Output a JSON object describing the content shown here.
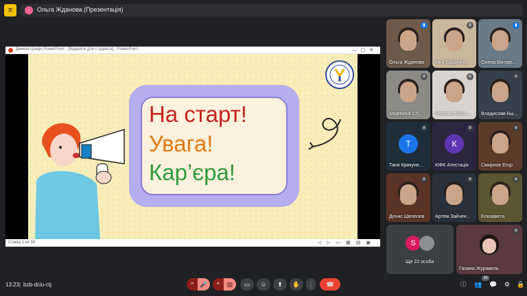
{
  "topbar": {
    "presenter": "Ольга Жданова (Презентація)"
  },
  "ppt": {
    "window_title": "Демонстрація PowerPoint - [Відкрити для студента] - PowerPoint",
    "status": "Слайд 1 из 18"
  },
  "slide": {
    "line1": "На старт!",
    "line2": "Увага!",
    "line3": "Кар’єра!",
    "colors": {
      "line1": "#c1231f",
      "line2": "#e07b17",
      "line3": "#2e9b3c",
      "frame": "#b7aef0"
    }
  },
  "participants": [
    {
      "name": "Ольга Жданова",
      "kind": "video",
      "bg": "#6d5a4a",
      "mic": "active"
    },
    {
      "name": "Інна Бардічев...",
      "kind": "video",
      "bg": "#c9b79e",
      "mic": "muted"
    },
    {
      "name": "Олена Вікторі...",
      "kind": "video",
      "bg": "#6a7a86",
      "mic": "active"
    },
    {
      "name": "smartwork Ch...",
      "kind": "video",
      "bg": "#8d8b86",
      "mic": "muted"
    },
    {
      "name": "Наталка Макс...",
      "kind": "video",
      "bg": "#d8d3ce",
      "mic": "muted"
    },
    {
      "name": "Владислав Бы...",
      "kind": "photo",
      "bg": "#35414c",
      "mic": "muted"
    },
    {
      "name": "Таня Крикуне...",
      "kind": "initial",
      "initial": "Т",
      "bg": "#1e2d3a",
      "avatar": "#1a73e8",
      "mic": "muted"
    },
    {
      "name": "КІФК Атестація",
      "kind": "initial",
      "initial": "К",
      "bg": "#2b2540",
      "avatar": "#5e35b1",
      "mic": "muted"
    },
    {
      "name": "Смирнов Егор",
      "kind": "photo",
      "bg": "#5c3a2a",
      "mic": "muted"
    },
    {
      "name": "Денис Шепелев",
      "kind": "photo",
      "bg": "#5b3428",
      "mic": "muted"
    },
    {
      "name": "Артем Зайчен...",
      "kind": "photo",
      "bg": "#28313b",
      "mic": "muted"
    },
    {
      "name": "Елизавета",
      "kind": "photo",
      "bg": "#5b5532",
      "mic": "muted"
    }
  ],
  "others": {
    "label": "Ще 22 особи",
    "initial": "S"
  },
  "pinned": {
    "name": "Галина Журавель"
  },
  "bottombar": {
    "time": "13:23",
    "separator": "|",
    "code": "bzb-dciu-ctj",
    "badge": "34"
  },
  "icons": {
    "mic_caret": "^",
    "mic": "🎤",
    "cam_caret": "^",
    "cam_off": "▧",
    "captions": "▭",
    "emoji": "☺",
    "present": "⬆",
    "hand": "✋",
    "more": "⋮",
    "leave": "☎",
    "info": "ⓘ",
    "people": "👥",
    "chat": "💬",
    "activities": "⚙",
    "lock": "🔒"
  }
}
